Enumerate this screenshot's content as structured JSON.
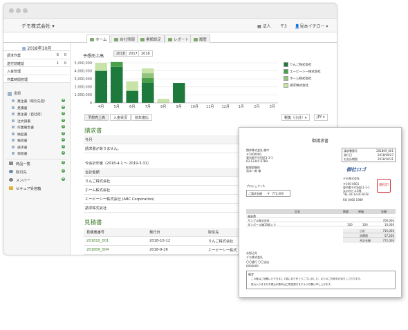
{
  "header": {
    "company": "デモ株式会社",
    "right_items": [
      "法人",
      "〒3",
      "見本イチロー"
    ]
  },
  "tabs": [
    "ホーム",
    "自社情報",
    "書類設定",
    "レポート",
    "履歴"
  ],
  "sidebar": {
    "month": "2018年10月",
    "stats": [
      {
        "label": "請求作業",
        "a": "6",
        "b": "0"
      },
      {
        "label": "送付前確認",
        "a": "1",
        "b": "0"
      },
      {
        "label": "入金管理",
        "a": "",
        "b": ""
      },
      {
        "label": "作業時間管理",
        "a": "",
        "b": ""
      }
    ],
    "docs_header": "書類",
    "docs": [
      "発注書（取引先宛）",
      "見積書",
      "発注書（自社宛）",
      "注文請書",
      "作業報告書",
      "納品書",
      "検収書",
      "請求書",
      "領収書"
    ],
    "bottom": [
      "商品一覧",
      "取引先",
      "メンバー",
      "セキュア受信箱"
    ]
  },
  "chart": {
    "title": "予想売上高",
    "years": [
      "2018",
      "2017",
      "2016"
    ],
    "tabs": [
      "予想売上高",
      "入金状況",
      "前年度比"
    ],
    "controls": [
      "税抜（小計）▾",
      "JPY ▾"
    ]
  },
  "chart_data": {
    "type": "bar",
    "stacked": true,
    "categories": [
      "4月",
      "5月",
      "6月",
      "7月",
      "8月",
      "9月",
      "10月",
      "11月",
      "12月",
      "1月",
      "2月",
      "3月"
    ],
    "series": [
      {
        "name": "りんご株式会社",
        "color": "#1e7a3c",
        "values": [
          4000000,
          4500000,
          1500000,
          2500000,
          0,
          2500000,
          0,
          0,
          0,
          0,
          0,
          0
        ]
      },
      {
        "name": "エービーシー株式会社",
        "color": "#4aa04a",
        "values": [
          0,
          600000,
          0,
          600000,
          0,
          0,
          0,
          0,
          0,
          0,
          0,
          0
        ]
      },
      {
        "name": "ホーム株式会社",
        "color": "#93c47d",
        "values": [
          0,
          0,
          0,
          600000,
          0,
          0,
          0,
          0,
          0,
          0,
          0,
          0
        ]
      },
      {
        "name": "請求株式会社",
        "color": "#c8e3a8",
        "values": [
          1000000,
          0,
          1200000,
          600000,
          500000,
          0,
          0,
          0,
          0,
          0,
          0,
          0
        ]
      }
    ],
    "y_ticks": [
      "5,000,000",
      "4,000,000",
      "3,000,000",
      "2,000,000",
      "1,000,000",
      "0"
    ],
    "ylim": [
      0,
      5000000
    ],
    "legend": "right",
    "grid": true
  },
  "invoices": {
    "title": "請求書",
    "month": "今月",
    "none": "請求書がありません。",
    "fiscal": "今会計年度（2018-4-1 ～ 2019-3-31）",
    "total_label": "合計金額",
    "clients": [
      "りんご株式会社",
      "ホーム株式会社",
      "エービーシー株式会社 (ABC Corporation)",
      "請求株式会社"
    ]
  },
  "estimates": {
    "title": "見積書",
    "headers": [
      "見積書番号",
      "発行日",
      "取引先"
    ],
    "rows": [
      {
        "no": "201810_001",
        "date": "2018-10-12",
        "client": "りんご株式会社"
      },
      {
        "no": "201809_004",
        "date": "2018-9-26",
        "client": "エービーシー株式"
      }
    ]
  },
  "invoice_doc": {
    "title": "御請求書",
    "client": "請求株式会社 御中",
    "addr1": "〒1000000",
    "addr2": "東京都千代田区1-1-1",
    "tel": "03-12345-6789",
    "mgr1": "経理部御担",
    "mgr2": "見本一郎 様",
    "project": "プロジェクトA",
    "amount_label": "ご請求金額",
    "amount": "¥　772,000",
    "meta": [
      {
        "k": "請求書番号",
        "v": "201809_001"
      },
      {
        "k": "発行日",
        "v": "2018/09/27"
      },
      {
        "k": "お支払期限",
        "v": "2018/10/31"
      }
    ],
    "logo": "御社ロゴ",
    "seal": "御社印",
    "issuer": "デモ株式会社",
    "issuer_addr": [
      "〒100-0001",
      "東京都千代田区1-1-1",
      "丸の内ビル1階"
    ],
    "issuer_tel": "TEL 03-1234-5678",
    "issuer_no": "RO 0460 1989",
    "item_headers": [
      "品名",
      "数量",
      "単価",
      "金額"
    ],
    "items": [
      {
        "name": "開発費",
        "qty": "",
        "price": "",
        "amount": ""
      },
      {
        "name": "サンプル株式会社",
        "qty": "",
        "price": "",
        "amount": "700,000"
      },
      {
        "name": "ダンボール箱10枚入り",
        "qty": "100",
        "price": "100",
        "amount": "10,000"
      }
    ],
    "summary": [
      {
        "k": "小計",
        "v": "715,000"
      },
      {
        "k": "消費税",
        "v": "57,200"
      },
      {
        "k": "合計金額",
        "v": "772,000"
      }
    ],
    "bank_label": "お振込先",
    "bank": [
      "デモ株式会社",
      "〇〇銀行 〇〇支店",
      "0000000"
    ],
    "notes_label": "備考",
    "note1": "この度はご依頼いただきまして誠にありがとうございました。またのご利用をお待ちしております。",
    "note2": "恐れ入りますがお振込手数料はご負担頂きますようお願い申し上げます。"
  }
}
